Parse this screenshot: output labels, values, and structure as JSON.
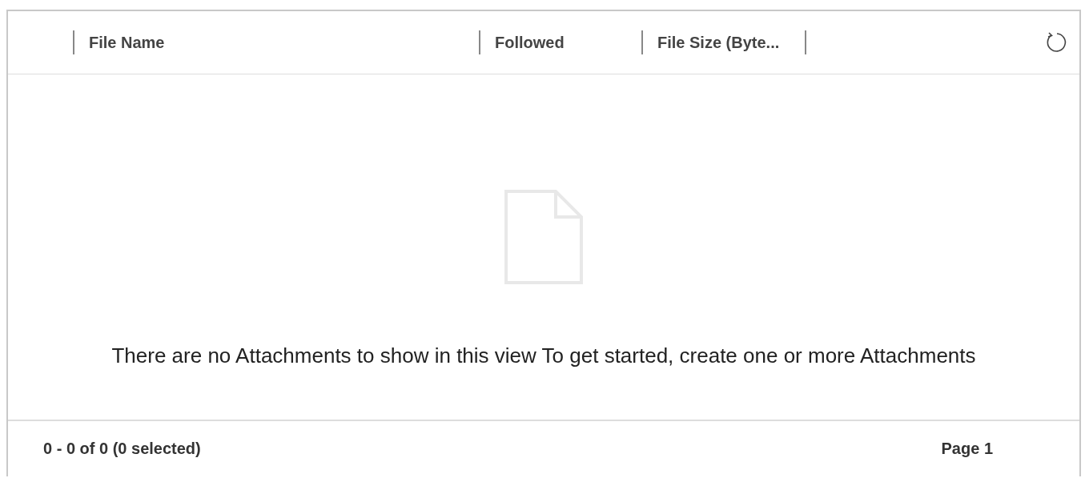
{
  "columns": [
    {
      "label": "File Name"
    },
    {
      "label": "Followed"
    },
    {
      "label": "File Size (Byte..."
    }
  ],
  "empty_message": "There are no Attachments to show in this view  To get started, create one or more Attachments",
  "status_bar": {
    "count": "0 - 0 of 0 (0 selected)",
    "page": "Page 1"
  }
}
